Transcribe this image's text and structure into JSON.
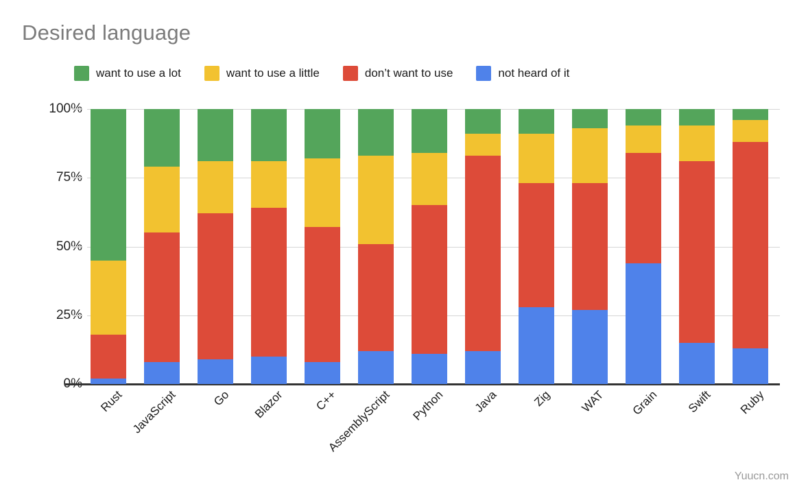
{
  "title": "Desired language",
  "watermark": "Yuucn.com",
  "colors": {
    "want_a_lot": "#54a55b",
    "want_a_little": "#f2c230",
    "dont_want": "#dd4b39",
    "not_heard": "#4f82ea",
    "grid": "#d5d5d5",
    "axis": "#333333",
    "title": "#7b7b7b",
    "label": "#1a1a1a",
    "watermark": "#9a9a9a"
  },
  "legend": [
    {
      "label": "want to use a lot",
      "color": "#54a55b",
      "key": "want_a_lot"
    },
    {
      "label": "want to use a little",
      "color": "#f2c230",
      "key": "want_a_little"
    },
    {
      "label": "don’t want to use",
      "color": "#dd4b39",
      "key": "dont_want"
    },
    {
      "label": "not heard of it",
      "color": "#4f82ea",
      "key": "not_heard"
    }
  ],
  "chart_data": {
    "type": "bar",
    "subtype": "stacked-percent",
    "title": "Desired language",
    "xlabel": "",
    "ylabel": "",
    "ylim": [
      0,
      100
    ],
    "yticks": [
      0,
      25,
      50,
      75,
      100
    ],
    "ytick_labels": [
      "0%",
      "25%",
      "50%",
      "75%",
      "100%"
    ],
    "grid": true,
    "legend_position": "top",
    "orientation": "vertical",
    "stack_order_bottom_to_top": [
      "not heard of it",
      "don’t want to use",
      "want to use a little",
      "want to use a lot"
    ],
    "categories": [
      "Rust",
      "JavaScript",
      "Go",
      "Blazor",
      "C++",
      "AssemblyScript",
      "Python",
      "Java",
      "Zig",
      "WAT",
      "Grain",
      "Swift",
      "Ruby"
    ],
    "series": [
      {
        "name": "want to use a lot",
        "color": "#54a55b",
        "values": [
          55,
          21,
          19,
          19,
          18,
          17,
          16,
          9,
          9,
          7,
          6,
          6,
          4
        ]
      },
      {
        "name": "want to use a little",
        "color": "#f2c230",
        "values": [
          27,
          24,
          19,
          17,
          25,
          32,
          19,
          8,
          18,
          20,
          10,
          13,
          8
        ]
      },
      {
        "name": "don’t want to use",
        "color": "#dd4b39",
        "values": [
          16,
          47,
          53,
          54,
          49,
          39,
          54,
          71,
          45,
          46,
          40,
          66,
          75
        ]
      },
      {
        "name": "not heard of it",
        "color": "#4f82ea",
        "values": [
          2,
          8,
          9,
          10,
          8,
          12,
          11,
          12,
          28,
          27,
          44,
          15,
          13
        ]
      }
    ],
    "cumulative_tops": {
      "Rust": {
        "not_heard": 2,
        "dont_want": 18,
        "want_a_little": 45,
        "want_a_lot": 100
      },
      "JavaScript": {
        "not_heard": 8,
        "dont_want": 55,
        "want_a_little": 79,
        "want_a_lot": 100
      },
      "Go": {
        "not_heard": 9,
        "dont_want": 62,
        "want_a_little": 81,
        "want_a_lot": 100
      },
      "Blazor": {
        "not_heard": 10,
        "dont_want": 64,
        "want_a_little": 81,
        "want_a_lot": 100
      },
      "C++": {
        "not_heard": 8,
        "dont_want": 57,
        "want_a_little": 82,
        "want_a_lot": 100
      },
      "AssemblyScript": {
        "not_heard": 12,
        "dont_want": 51,
        "want_a_little": 83,
        "want_a_lot": 100
      },
      "Python": {
        "not_heard": 11,
        "dont_want": 65,
        "want_a_little": 84,
        "want_a_lot": 100
      },
      "Java": {
        "not_heard": 12,
        "dont_want": 83,
        "want_a_little": 91,
        "want_a_lot": 100
      },
      "Zig": {
        "not_heard": 28,
        "dont_want": 73,
        "want_a_little": 91,
        "want_a_lot": 100
      },
      "WAT": {
        "not_heard": 27,
        "dont_want": 73,
        "want_a_little": 93,
        "want_a_lot": 100
      },
      "Grain": {
        "not_heard": 44,
        "dont_want": 84,
        "want_a_little": 94,
        "want_a_lot": 100
      },
      "Swift": {
        "not_heard": 15,
        "dont_want": 81,
        "want_a_little": 94,
        "want_a_lot": 100
      },
      "Ruby": {
        "not_heard": 13,
        "dont_want": 88,
        "want_a_little": 96,
        "want_a_lot": 100
      }
    }
  }
}
